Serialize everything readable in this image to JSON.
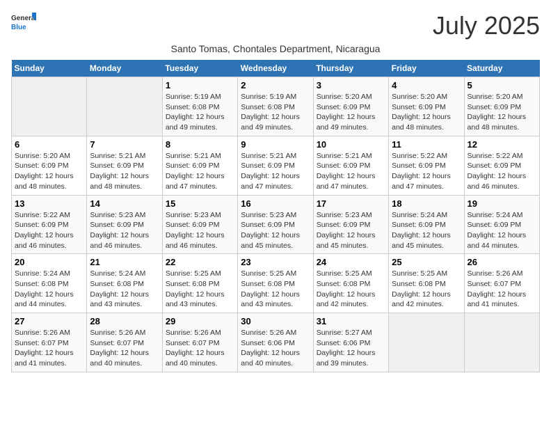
{
  "logo": {
    "general": "General",
    "blue": "Blue"
  },
  "title": "July 2025",
  "subtitle": "Santo Tomas, Chontales Department, Nicaragua",
  "days_header": [
    "Sunday",
    "Monday",
    "Tuesday",
    "Wednesday",
    "Thursday",
    "Friday",
    "Saturday"
  ],
  "weeks": [
    [
      {
        "day": "",
        "info": ""
      },
      {
        "day": "",
        "info": ""
      },
      {
        "day": "1",
        "sunrise": "5:19 AM",
        "sunset": "6:08 PM",
        "daylight": "12 hours and 49 minutes."
      },
      {
        "day": "2",
        "sunrise": "5:19 AM",
        "sunset": "6:08 PM",
        "daylight": "12 hours and 49 minutes."
      },
      {
        "day": "3",
        "sunrise": "5:20 AM",
        "sunset": "6:09 PM",
        "daylight": "12 hours and 49 minutes."
      },
      {
        "day": "4",
        "sunrise": "5:20 AM",
        "sunset": "6:09 PM",
        "daylight": "12 hours and 48 minutes."
      },
      {
        "day": "5",
        "sunrise": "5:20 AM",
        "sunset": "6:09 PM",
        "daylight": "12 hours and 48 minutes."
      }
    ],
    [
      {
        "day": "6",
        "sunrise": "5:20 AM",
        "sunset": "6:09 PM",
        "daylight": "12 hours and 48 minutes."
      },
      {
        "day": "7",
        "sunrise": "5:21 AM",
        "sunset": "6:09 PM",
        "daylight": "12 hours and 48 minutes."
      },
      {
        "day": "8",
        "sunrise": "5:21 AM",
        "sunset": "6:09 PM",
        "daylight": "12 hours and 47 minutes."
      },
      {
        "day": "9",
        "sunrise": "5:21 AM",
        "sunset": "6:09 PM",
        "daylight": "12 hours and 47 minutes."
      },
      {
        "day": "10",
        "sunrise": "5:21 AM",
        "sunset": "6:09 PM",
        "daylight": "12 hours and 47 minutes."
      },
      {
        "day": "11",
        "sunrise": "5:22 AM",
        "sunset": "6:09 PM",
        "daylight": "12 hours and 47 minutes."
      },
      {
        "day": "12",
        "sunrise": "5:22 AM",
        "sunset": "6:09 PM",
        "daylight": "12 hours and 46 minutes."
      }
    ],
    [
      {
        "day": "13",
        "sunrise": "5:22 AM",
        "sunset": "6:09 PM",
        "daylight": "12 hours and 46 minutes."
      },
      {
        "day": "14",
        "sunrise": "5:23 AM",
        "sunset": "6:09 PM",
        "daylight": "12 hours and 46 minutes."
      },
      {
        "day": "15",
        "sunrise": "5:23 AM",
        "sunset": "6:09 PM",
        "daylight": "12 hours and 46 minutes."
      },
      {
        "day": "16",
        "sunrise": "5:23 AM",
        "sunset": "6:09 PM",
        "daylight": "12 hours and 45 minutes."
      },
      {
        "day": "17",
        "sunrise": "5:23 AM",
        "sunset": "6:09 PM",
        "daylight": "12 hours and 45 minutes."
      },
      {
        "day": "18",
        "sunrise": "5:24 AM",
        "sunset": "6:09 PM",
        "daylight": "12 hours and 45 minutes."
      },
      {
        "day": "19",
        "sunrise": "5:24 AM",
        "sunset": "6:09 PM",
        "daylight": "12 hours and 44 minutes."
      }
    ],
    [
      {
        "day": "20",
        "sunrise": "5:24 AM",
        "sunset": "6:08 PM",
        "daylight": "12 hours and 44 minutes."
      },
      {
        "day": "21",
        "sunrise": "5:24 AM",
        "sunset": "6:08 PM",
        "daylight": "12 hours and 43 minutes."
      },
      {
        "day": "22",
        "sunrise": "5:25 AM",
        "sunset": "6:08 PM",
        "daylight": "12 hours and 43 minutes."
      },
      {
        "day": "23",
        "sunrise": "5:25 AM",
        "sunset": "6:08 PM",
        "daylight": "12 hours and 43 minutes."
      },
      {
        "day": "24",
        "sunrise": "5:25 AM",
        "sunset": "6:08 PM",
        "daylight": "12 hours and 42 minutes."
      },
      {
        "day": "25",
        "sunrise": "5:25 AM",
        "sunset": "6:08 PM",
        "daylight": "12 hours and 42 minutes."
      },
      {
        "day": "26",
        "sunrise": "5:26 AM",
        "sunset": "6:07 PM",
        "daylight": "12 hours and 41 minutes."
      }
    ],
    [
      {
        "day": "27",
        "sunrise": "5:26 AM",
        "sunset": "6:07 PM",
        "daylight": "12 hours and 41 minutes."
      },
      {
        "day": "28",
        "sunrise": "5:26 AM",
        "sunset": "6:07 PM",
        "daylight": "12 hours and 40 minutes."
      },
      {
        "day": "29",
        "sunrise": "5:26 AM",
        "sunset": "6:07 PM",
        "daylight": "12 hours and 40 minutes."
      },
      {
        "day": "30",
        "sunrise": "5:26 AM",
        "sunset": "6:06 PM",
        "daylight": "12 hours and 40 minutes."
      },
      {
        "day": "31",
        "sunrise": "5:27 AM",
        "sunset": "6:06 PM",
        "daylight": "12 hours and 39 minutes."
      },
      {
        "day": "",
        "info": ""
      },
      {
        "day": "",
        "info": ""
      }
    ]
  ]
}
